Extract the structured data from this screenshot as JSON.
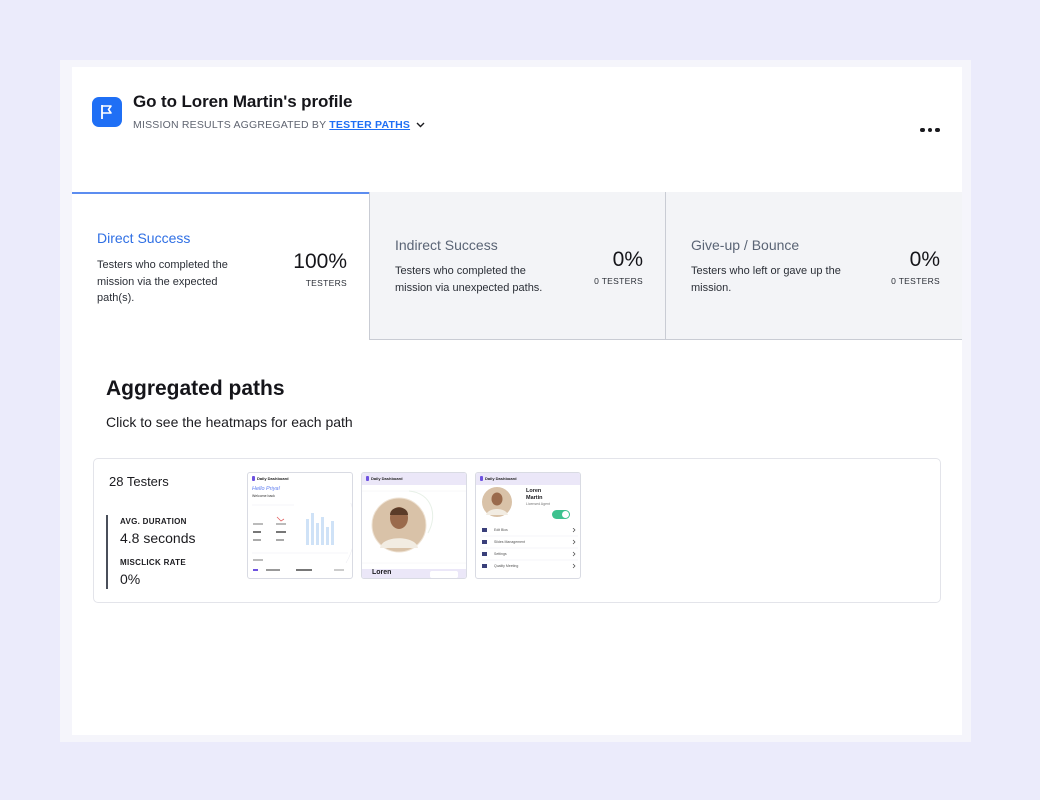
{
  "header": {
    "title": "Go to Loren Martin's profile",
    "aggregated_by_label": "MISSION RESULTS AGGREGATED BY",
    "aggregated_by_value": "TESTER PATHS"
  },
  "stats": [
    {
      "name": "Direct Success",
      "description": "Testers who completed the mission via the expected path(s).",
      "value": "100%",
      "unit": "TESTERS",
      "active": true
    },
    {
      "name": "Indirect Success",
      "description": "Testers who completed the mission via unexpected paths.",
      "value": "0%",
      "unit": "0 TESTERS",
      "active": false
    },
    {
      "name": "Give-up / Bounce",
      "description": "Testers who left or gave up the mission.",
      "value": "0%",
      "unit": "0 TESTERS",
      "active": false
    }
  ],
  "aggregated": {
    "title": "Aggregated paths",
    "subtitle": "Click to see the heatmaps for each path"
  },
  "path": {
    "testers": "28 Testers",
    "avg_duration_label": "AVG. DURATION",
    "avg_duration_value": "4.8 seconds",
    "misclick_label": "MISCLICK RATE",
    "misclick_value": "0%"
  },
  "thumbnails": {
    "app_name": "Daily Dashboard",
    "screen1": {
      "greeting": "Hello Priya!",
      "sub": "Welcome back"
    },
    "screen2": {
      "name": "Loren"
    },
    "screen3": {
      "first_name": "Loren",
      "last_name": "Martin",
      "role": "Licensed Agent",
      "menu": [
        "Edit Bios",
        "Slides Management",
        "Settings",
        "Quality Meeting"
      ]
    }
  },
  "colors": {
    "accent": "#1f6ff5",
    "active_tab": "#2f6fe4",
    "page_bg": "#ebebfb",
    "toggle": "#3ec28f",
    "thumb_accent": "#6e52e0"
  }
}
